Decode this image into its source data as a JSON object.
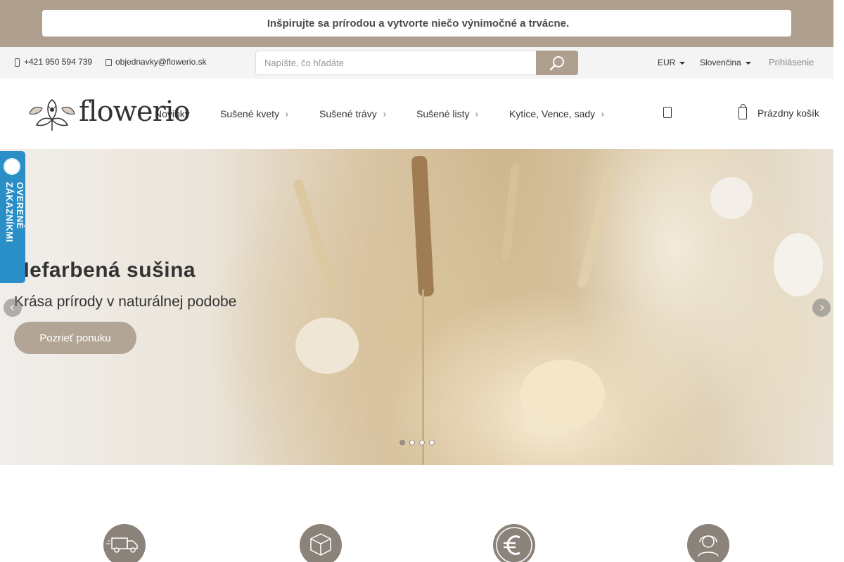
{
  "promo": {
    "text": "Inšpirujte sa prírodou a vytvorte niečo výnimočné a trvácne.",
    "bolt_icon": "",
    "close_icon": ""
  },
  "contact": {
    "phone": "+421 950 594 739",
    "email": "objednavky@flowerio.sk"
  },
  "search": {
    "placeholder": "Napíšte, čo hľadáte",
    "value": ""
  },
  "utility": {
    "currency": "EUR",
    "language": "Slovenčina",
    "login": "Prihlásenie"
  },
  "logo": {
    "text": "flowerio"
  },
  "nav": [
    {
      "label": "Novinky"
    },
    {
      "label": "Sušené kvety"
    },
    {
      "label": "Sušené trávy"
    },
    {
      "label": "Sušené listy"
    },
    {
      "label": "Kytice, Vence, sady"
    }
  ],
  "cart": {
    "label": "Prázdny košík"
  },
  "hero": {
    "title": "Nefarbená sušina",
    "subtitle": "Krása prírody v naturálnej podobe",
    "button": "Pozrieť ponuku",
    "slides_count": 4,
    "active_slide": 1
  },
  "badge": {
    "text": "OVERENÉ ZÁKAZNÍKMI"
  },
  "features": [
    {
      "icon": "truck-icon"
    },
    {
      "icon": "box-icon"
    },
    {
      "icon": "euro-icon"
    },
    {
      "icon": "support-agent-icon"
    }
  ],
  "colors": {
    "brand": "#ae9f8e",
    "hero_button": "#b2a595",
    "badge": "#2a8fc6",
    "feature_icon_bg": "#8b8279"
  }
}
